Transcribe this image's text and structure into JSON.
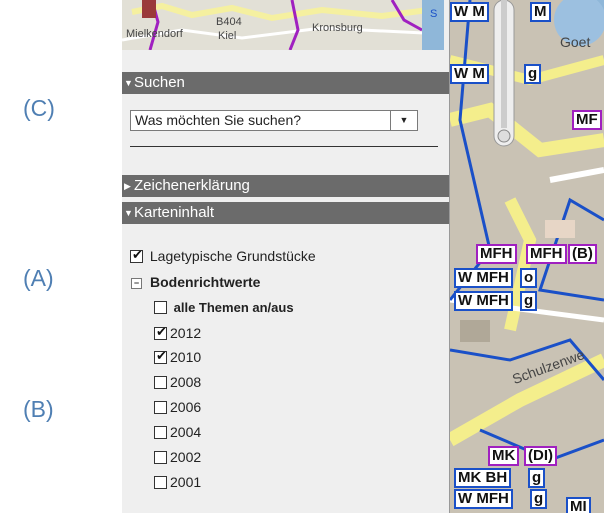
{
  "figure_labels": [
    "(C)",
    "(A)",
    "(B)"
  ],
  "overview_map": {
    "places": [
      "Mielkendorf",
      "Kiel",
      "B404",
      "Kronsburg",
      "S"
    ]
  },
  "search": {
    "header": "Suchen",
    "selected": "Was möchten Sie suchen?"
  },
  "legend": {
    "header": "Zeichenerklärung"
  },
  "content": {
    "header": "Karteninhalt",
    "lagetypische": {
      "label": "Lagetypische Grundstücke",
      "checked": true
    },
    "bodenrichtwerte": {
      "label": "Bodenrichtwerte",
      "toggle_all": {
        "label": "alle Themen an/aus",
        "checked": false
      },
      "years": [
        {
          "label": "2012",
          "checked": true
        },
        {
          "label": "2010",
          "checked": true
        },
        {
          "label": "2008",
          "checked": false
        },
        {
          "label": "2006",
          "checked": false
        },
        {
          "label": "2004",
          "checked": false
        },
        {
          "label": "2002",
          "checked": false
        },
        {
          "label": "2001",
          "checked": false
        }
      ]
    }
  },
  "map": {
    "tags": [
      "W M",
      "M",
      "W M",
      "g",
      "MF",
      "MFH",
      "MFH",
      "(B)",
      "W MFH",
      "o",
      "W MFH",
      "g",
      "MK",
      "(DI)",
      "MK BH",
      "g",
      "W MFH",
      "g",
      "MI"
    ],
    "streets": [
      "Goet",
      "Schulzenwe"
    ]
  },
  "colors": {
    "header_bg": "#6b6b6b",
    "panel_bg": "#efefef",
    "label_blue": "#4f7fb3",
    "zone_blue": "#1a50c8",
    "zone_purple": "#a020c0"
  }
}
